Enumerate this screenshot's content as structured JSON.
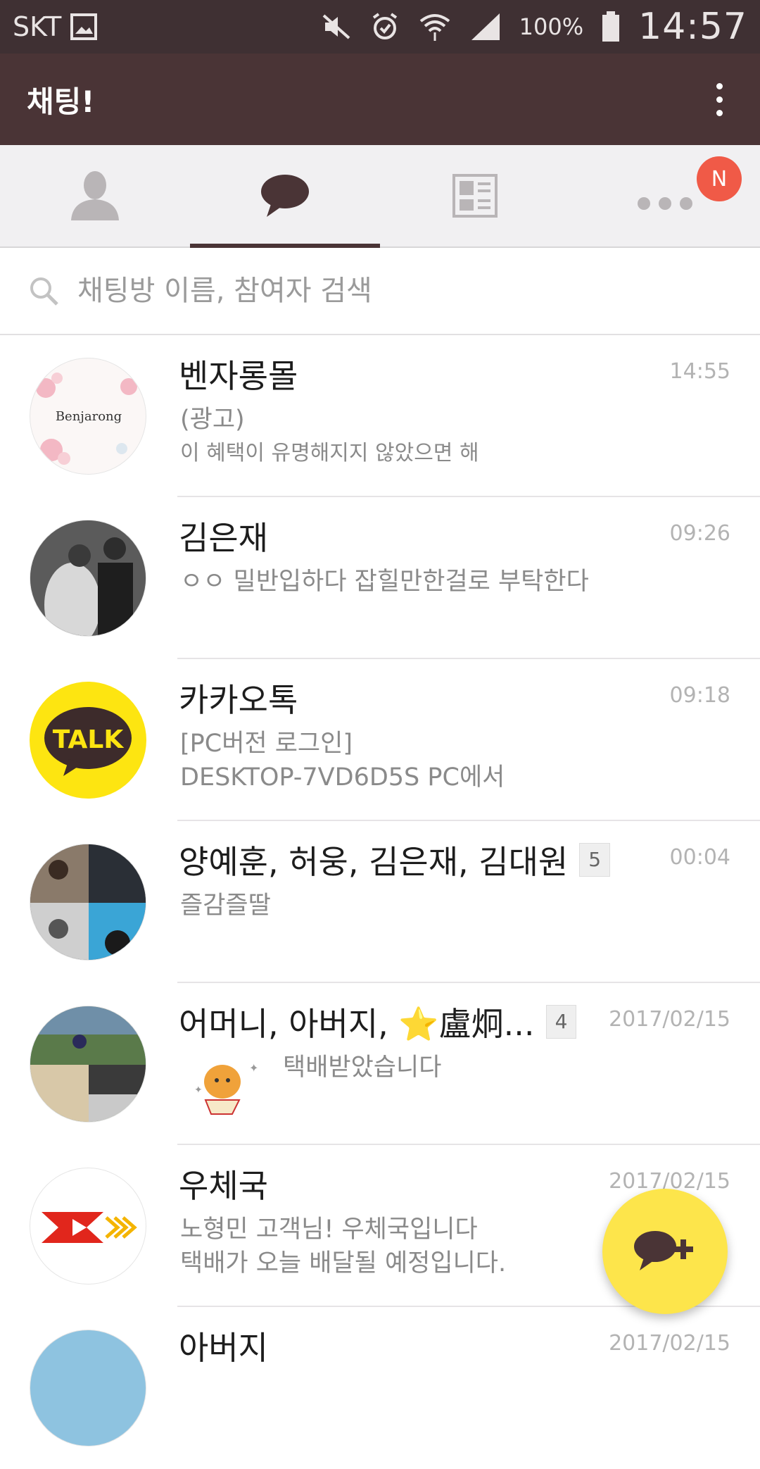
{
  "status_bar": {
    "carrier": "SKT",
    "battery": "100%",
    "time": "14:57"
  },
  "app_bar": {
    "title": "채팅!",
    "menu_icon": "more-vert-icon"
  },
  "tabs": [
    {
      "name": "friends",
      "icon": "person-icon",
      "active": false
    },
    {
      "name": "chats",
      "icon": "chat-bubble-icon",
      "active": true
    },
    {
      "name": "news",
      "icon": "news-icon",
      "active": false
    },
    {
      "name": "more",
      "icon": "more-horiz-icon",
      "active": false,
      "badge": "N"
    }
  ],
  "search": {
    "placeholder": "채팅방 이름, 참여자 검색"
  },
  "chats": [
    {
      "name": "벤자롱몰",
      "time": "14:55",
      "line1": "(광고)",
      "line2": "이 혜택이 유명해지지 않았으면 해",
      "avatar_text": "Benjarong"
    },
    {
      "name": "김은재",
      "time": "09:26",
      "line1": "ㅇㅇ 밀반입하다 잡힐만한걸로 부탁한다",
      "line2": ""
    },
    {
      "name": "카카오톡",
      "time": "09:18",
      "line1": "[PC버전 로그인]",
      "line2": "DESKTOP-7VD6D5S PC에서",
      "avatar_text": "TALK"
    },
    {
      "name": "양예훈, 허웅, 김은재, 김대원",
      "count": "5",
      "time": "00:04",
      "line1": "즐감즐딸",
      "line2": ""
    },
    {
      "name": "어머니, 아버지, ⭐盧炯...",
      "count": "4",
      "time": "2017/02/15",
      "line1": "택배받았습니다",
      "line2": ""
    },
    {
      "name": "우체국",
      "time": "2017/02/15",
      "line1": "노형민 고객님! 우체국입니다",
      "line2": "택배가 오늘 배달될 예정입니다."
    },
    {
      "name": "아버지",
      "time": "2017/02/15",
      "line1": "",
      "line2": ""
    }
  ],
  "colors": {
    "status_bar": "#3f3033",
    "app_bar": "#4a3436",
    "accent_yellow": "#fde54b",
    "badge_red": "#f05a47"
  },
  "fab": {
    "icon": "new-chat-plus-icon"
  }
}
